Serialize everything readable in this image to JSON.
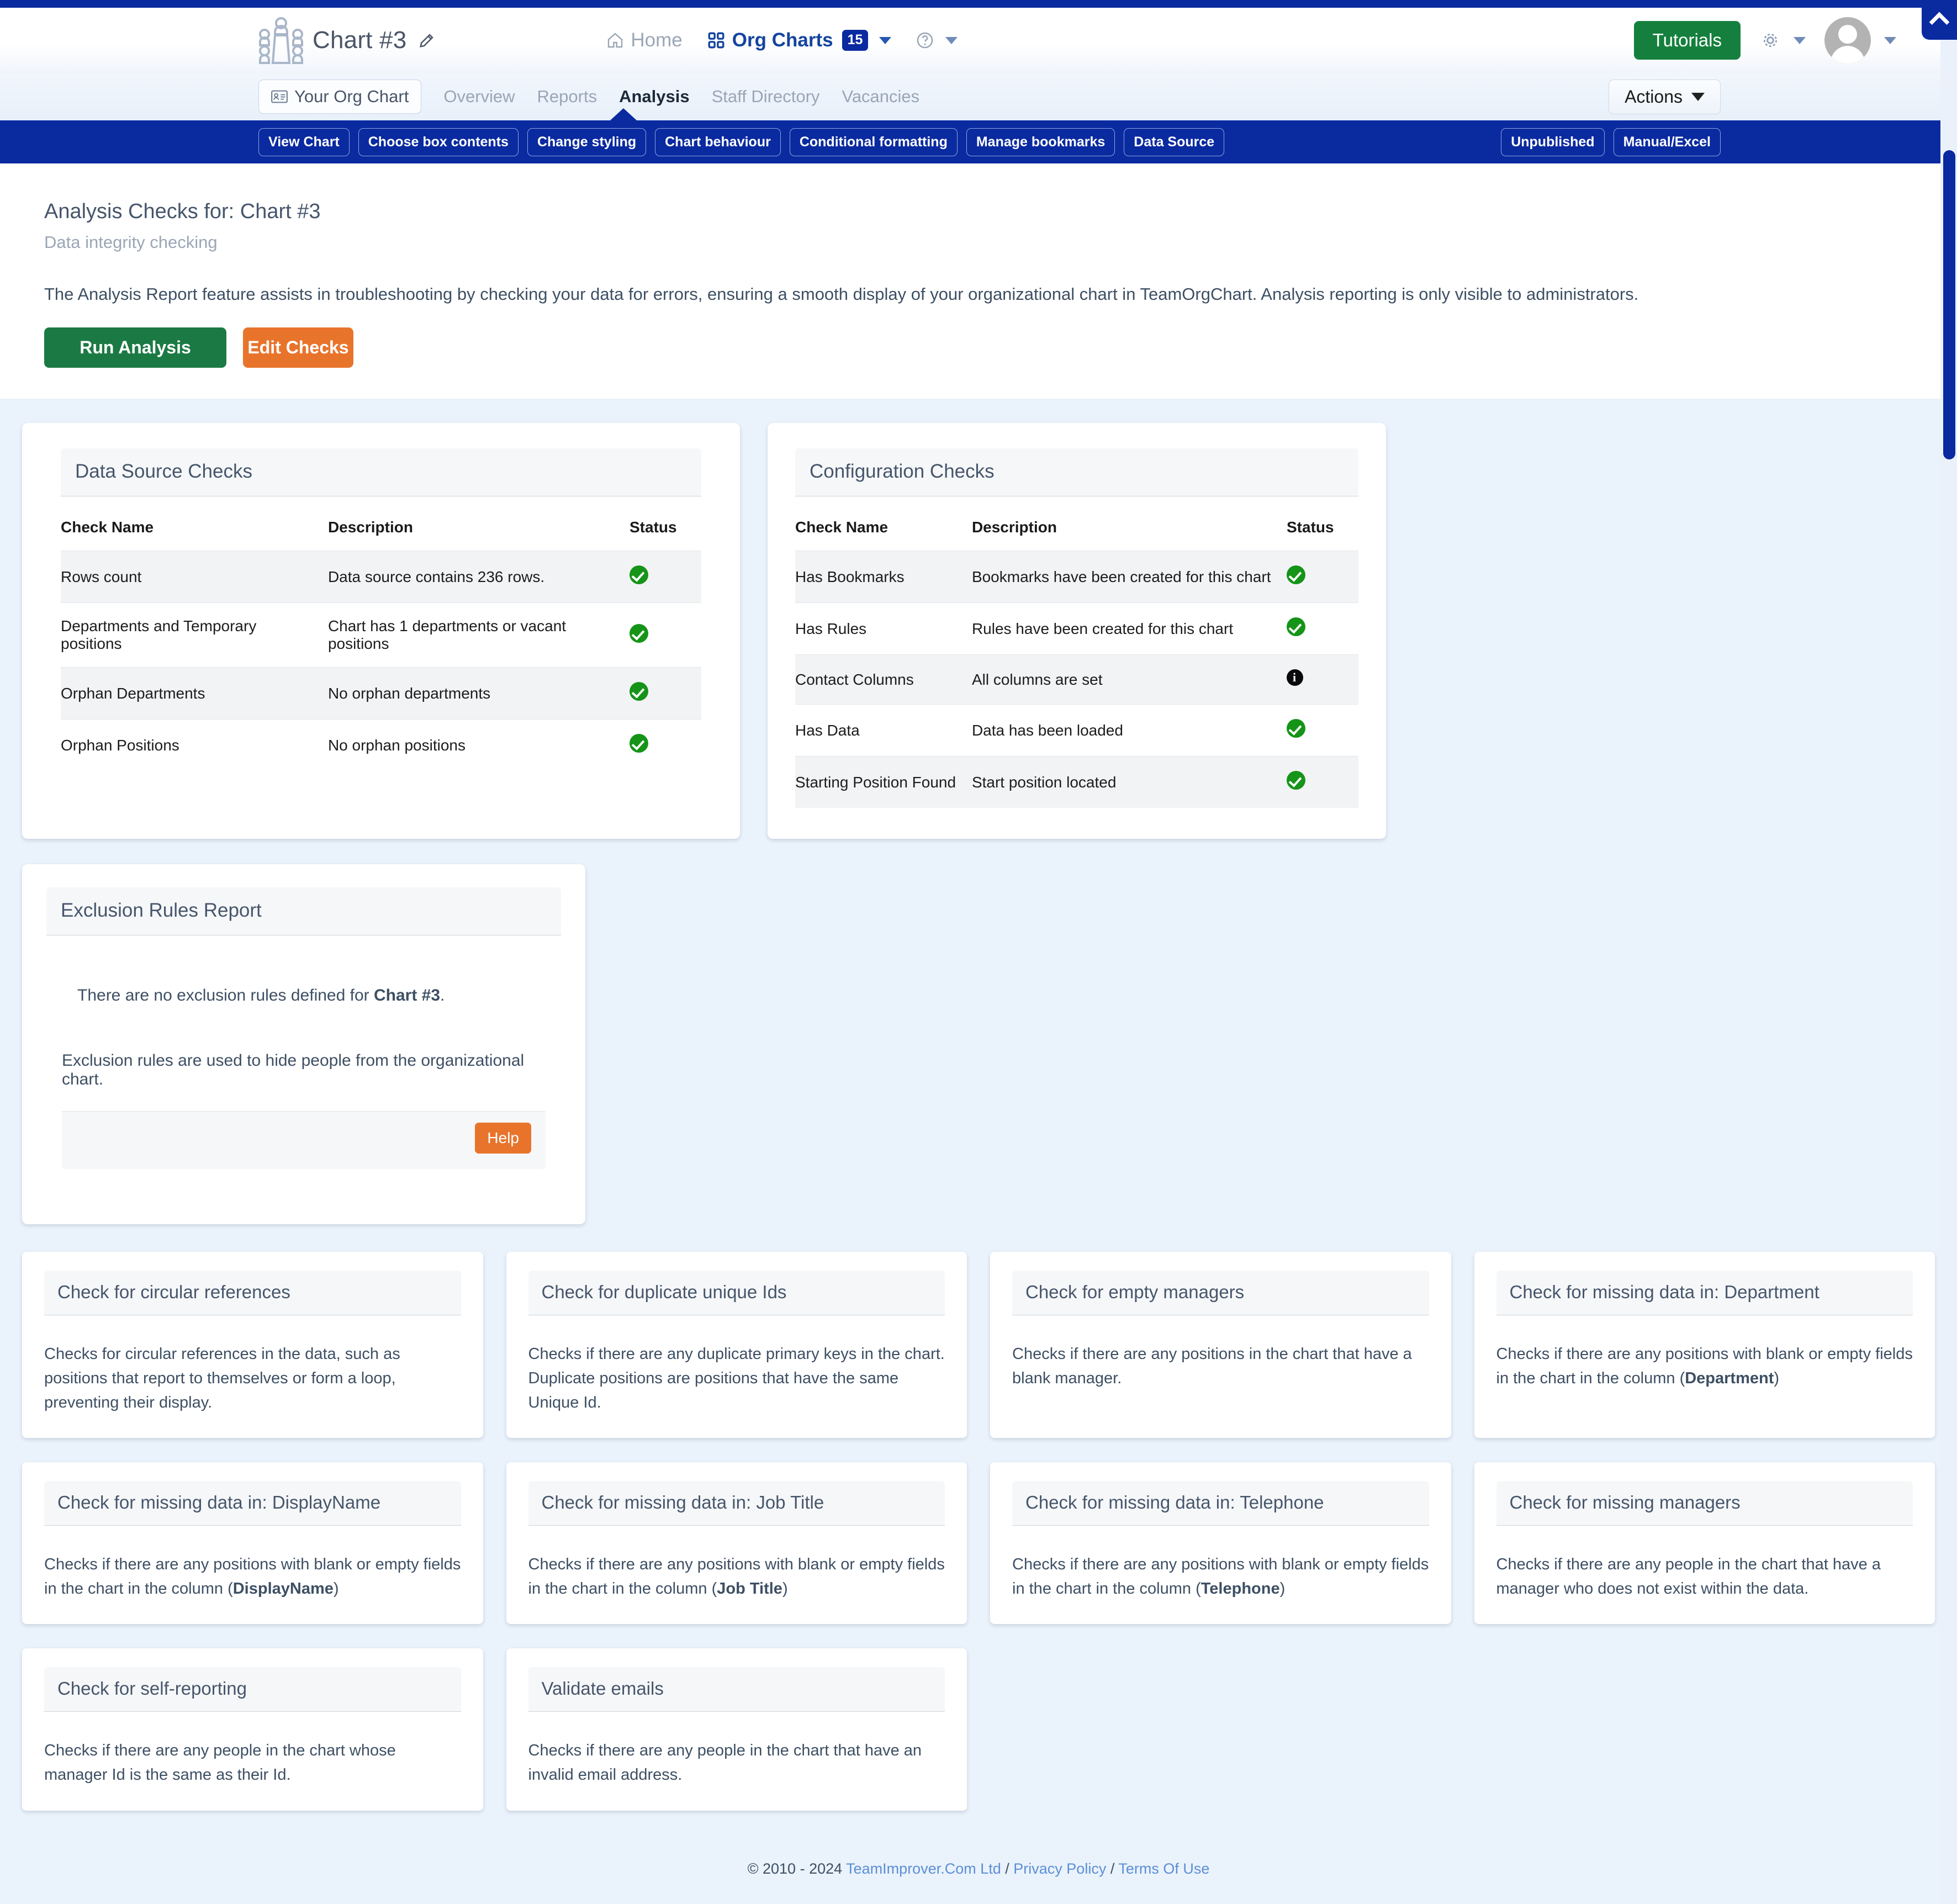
{
  "header": {
    "chart_title": "Chart #3",
    "logo_icon": "org-chart-people-icon",
    "edit_icon": "pencil-icon",
    "nav": {
      "home": "Home",
      "home_icon": "home-icon",
      "org_charts": "Org Charts",
      "org_charts_icon": "grid-apps-icon",
      "org_charts_count": "15",
      "help_icon": "question-circle-icon"
    },
    "tutorials_label": "Tutorials",
    "settings_icon": "gear-icon",
    "avatar_icon": "user-avatar"
  },
  "subnav": {
    "org_chart_tab": "Your Org Chart",
    "org_chart_icon": "id-card-icon",
    "tabs": [
      {
        "label": "Overview",
        "active": false
      },
      {
        "label": "Reports",
        "active": false
      },
      {
        "label": "Analysis",
        "active": true
      },
      {
        "label": "Staff Directory",
        "active": false
      },
      {
        "label": "Vacancies",
        "active": false
      }
    ],
    "actions_label": "Actions"
  },
  "toolbar": {
    "buttons": [
      "View Chart",
      "Choose box contents",
      "Change styling",
      "Chart behaviour",
      "Conditional formatting",
      "Manage bookmarks",
      "Data Source"
    ],
    "right_buttons": [
      "Unpublished",
      "Manual/Excel"
    ]
  },
  "intro": {
    "title": "Analysis Checks for: Chart #3",
    "subtitle": "Data integrity checking",
    "description": "The Analysis Report feature assists in troubleshooting by checking your data for errors, ensuring a smooth display of your organizational chart in TeamOrgChart. Analysis reporting is only visible to administrators.",
    "run_label": "Run Analysis",
    "edit_label": "Edit Checks"
  },
  "data_source_checks": {
    "title": "Data Source Checks",
    "columns": [
      "Check Name",
      "Description",
      "Status"
    ],
    "rows": [
      {
        "name": "Rows count",
        "description": "Data source contains 236 rows.",
        "status": "ok",
        "link": false
      },
      {
        "name": "Departments and Temporary positions",
        "description": "Chart has 1 departments or vacant positions",
        "status": "ok",
        "link": false
      },
      {
        "name": "Orphan Departments",
        "description": "No orphan departments",
        "status": "ok",
        "link": false
      },
      {
        "name": "Orphan Positions",
        "description": "No orphan positions",
        "status": "ok",
        "link": false
      }
    ]
  },
  "configuration_checks": {
    "title": "Configuration Checks",
    "columns": [
      "Check Name",
      "Description",
      "Status"
    ],
    "rows": [
      {
        "name": "Has Bookmarks",
        "description": "Bookmarks have been created for this chart",
        "status": "ok",
        "link": true
      },
      {
        "name": "Has Rules",
        "description": "Rules have been created for this chart",
        "status": "ok",
        "link": true
      },
      {
        "name": "Contact Columns",
        "description": "All columns are set",
        "status": "info",
        "link": true
      },
      {
        "name": "Has Data",
        "description": "Data has been loaded",
        "status": "ok",
        "link": false
      },
      {
        "name": "Starting Position Found",
        "description": "Start position located",
        "status": "ok",
        "link": false
      }
    ]
  },
  "exclusion_rules": {
    "title": "Exclusion Rules Report",
    "line1_prefix": "There are no exclusion rules defined for ",
    "line1_bold": "Chart #3",
    "line1_suffix": ".",
    "line2": "Exclusion rules are used to hide people from the organizational chart.",
    "help_label": "Help"
  },
  "check_cards": [
    {
      "title": "Check for circular references",
      "description": "Checks for circular references in the data, such as positions that report to themselves or form a loop, preventing their display.",
      "bold": ""
    },
    {
      "title": "Check for duplicate unique Ids",
      "description": "Checks if there are any duplicate primary keys in the chart. Duplicate positions are positions that have the same Unique Id.",
      "bold": ""
    },
    {
      "title": "Check for empty managers",
      "description": "Checks if there are any positions in the chart that have a blank manager.",
      "bold": ""
    },
    {
      "title": "Check for missing data in: Department",
      "description": "Checks if there are any positions with blank or empty fields in the chart in the column (",
      "bold": "Department",
      "suffix": ")"
    },
    {
      "title": "Check for missing data in: DisplayName",
      "description": "Checks if there are any positions with blank or empty fields in the chart in the column (",
      "bold": "DisplayName",
      "suffix": ")"
    },
    {
      "title": "Check for missing data in: Job Title",
      "description": "Checks if there are any positions with blank or empty fields in the chart in the column (",
      "bold": "Job Title",
      "suffix": ")"
    },
    {
      "title": "Check for missing data in: Telephone",
      "description": "Checks if there are any positions with blank or empty fields in the chart in the column (",
      "bold": "Telephone",
      "suffix": ")"
    },
    {
      "title": "Check for missing managers",
      "description": "Checks if there are any people in the chart that have a manager who does not exist within the data.",
      "bold": ""
    },
    {
      "title": "Check for self-reporting",
      "description": "Checks if there are any people in the chart whose manager Id is the same as their Id.",
      "bold": ""
    },
    {
      "title": "Validate emails",
      "description": "Checks if there are any people in the chart that have an invalid email address.",
      "bold": ""
    }
  ],
  "footer": {
    "copyright": "© 2010 - 2024 ",
    "company": "TeamImprover.Com Ltd",
    "sep1": " / ",
    "privacy": "Privacy Policy",
    "sep2": " / ",
    "terms": "Terms Of Use"
  },
  "colors": {
    "brand_blue": "#0a2aa0",
    "green": "#1b7a44",
    "orange": "#e8742c",
    "link_blue": "#5b8fd6",
    "status_green": "#159418"
  }
}
